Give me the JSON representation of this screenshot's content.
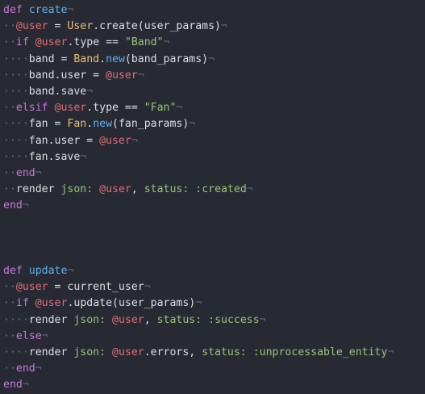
{
  "editor": {
    "colors": {
      "background": "#272a33",
      "plain": "#dcdfe4",
      "keyword": "#c678dd",
      "function": "#61afef",
      "ivar": "#e06c75",
      "constant": "#e5c07b",
      "string": "#98c379",
      "whitespace": "#5f6a7d"
    },
    "lines": [
      [
        {
          "t": "kw",
          "v": "def"
        },
        {
          "t": "plain",
          "v": " "
        },
        {
          "t": "fn",
          "v": "create"
        },
        {
          "t": "eol",
          "v": "¬"
        }
      ],
      [
        {
          "t": "ws",
          "v": "··"
        },
        {
          "t": "ivar",
          "v": "@user"
        },
        {
          "t": "plain",
          "v": " = "
        },
        {
          "t": "const",
          "v": "User"
        },
        {
          "t": "plain",
          "v": ".create(user_params)"
        },
        {
          "t": "eol",
          "v": "¬"
        }
      ],
      [
        {
          "t": "ws",
          "v": "··"
        },
        {
          "t": "kw",
          "v": "if"
        },
        {
          "t": "plain",
          "v": " "
        },
        {
          "t": "ivar",
          "v": "@user"
        },
        {
          "t": "plain",
          "v": ".type == "
        },
        {
          "t": "str",
          "v": "\"Band\""
        },
        {
          "t": "eol",
          "v": "¬"
        }
      ],
      [
        {
          "t": "ws",
          "v": "····"
        },
        {
          "t": "plain",
          "v": "band = "
        },
        {
          "t": "const",
          "v": "Band"
        },
        {
          "t": "plain",
          "v": "."
        },
        {
          "t": "method",
          "v": "new"
        },
        {
          "t": "plain",
          "v": "(band_params)"
        },
        {
          "t": "eol",
          "v": "¬"
        }
      ],
      [
        {
          "t": "ws",
          "v": "····"
        },
        {
          "t": "plain",
          "v": "band.user = "
        },
        {
          "t": "ivar",
          "v": "@user"
        },
        {
          "t": "eol",
          "v": "¬"
        }
      ],
      [
        {
          "t": "ws",
          "v": "····"
        },
        {
          "t": "plain",
          "v": "band.save"
        },
        {
          "t": "eol",
          "v": "¬"
        }
      ],
      [
        {
          "t": "ws",
          "v": "··"
        },
        {
          "t": "kw",
          "v": "elsif"
        },
        {
          "t": "plain",
          "v": " "
        },
        {
          "t": "ivar",
          "v": "@user"
        },
        {
          "t": "plain",
          "v": ".type == "
        },
        {
          "t": "str",
          "v": "\"Fan\""
        },
        {
          "t": "eol",
          "v": "¬"
        }
      ],
      [
        {
          "t": "ws",
          "v": "····"
        },
        {
          "t": "plain",
          "v": "fan = "
        },
        {
          "t": "const",
          "v": "Fan"
        },
        {
          "t": "plain",
          "v": "."
        },
        {
          "t": "method",
          "v": "new"
        },
        {
          "t": "plain",
          "v": "(fan_params)"
        },
        {
          "t": "eol",
          "v": "¬"
        }
      ],
      [
        {
          "t": "ws",
          "v": "····"
        },
        {
          "t": "plain",
          "v": "fan.user = "
        },
        {
          "t": "ivar",
          "v": "@user"
        },
        {
          "t": "eol",
          "v": "¬"
        }
      ],
      [
        {
          "t": "ws",
          "v": "····"
        },
        {
          "t": "plain",
          "v": "fan.save"
        },
        {
          "t": "eol",
          "v": "¬"
        }
      ],
      [
        {
          "t": "ws",
          "v": "··"
        },
        {
          "t": "kw",
          "v": "end"
        },
        {
          "t": "eol",
          "v": "¬"
        }
      ],
      [
        {
          "t": "ws",
          "v": "··"
        },
        {
          "t": "plain",
          "v": "render "
        },
        {
          "t": "key",
          "v": "json:"
        },
        {
          "t": "plain",
          "v": " "
        },
        {
          "t": "ivar",
          "v": "@user"
        },
        {
          "t": "plain",
          "v": ", "
        },
        {
          "t": "key",
          "v": "status:"
        },
        {
          "t": "plain",
          "v": " "
        },
        {
          "t": "sym",
          "v": ":created"
        },
        {
          "t": "eol",
          "v": "¬"
        }
      ],
      [
        {
          "t": "kw",
          "v": "end"
        },
        {
          "t": "eol",
          "v": "¬"
        }
      ],
      [],
      [],
      [],
      [
        {
          "t": "kw",
          "v": "def"
        },
        {
          "t": "plain",
          "v": " "
        },
        {
          "t": "fn",
          "v": "update"
        },
        {
          "t": "eol",
          "v": "¬"
        }
      ],
      [
        {
          "t": "ws",
          "v": "··"
        },
        {
          "t": "ivar",
          "v": "@user"
        },
        {
          "t": "plain",
          "v": " = current_user"
        },
        {
          "t": "eol",
          "v": "¬"
        }
      ],
      [
        {
          "t": "ws",
          "v": "··"
        },
        {
          "t": "kw",
          "v": "if"
        },
        {
          "t": "plain",
          "v": " "
        },
        {
          "t": "ivar",
          "v": "@user"
        },
        {
          "t": "plain",
          "v": ".update(user_params)"
        },
        {
          "t": "eol",
          "v": "¬"
        }
      ],
      [
        {
          "t": "ws",
          "v": "····"
        },
        {
          "t": "plain",
          "v": "render "
        },
        {
          "t": "key",
          "v": "json:"
        },
        {
          "t": "plain",
          "v": " "
        },
        {
          "t": "ivar",
          "v": "@user"
        },
        {
          "t": "plain",
          "v": ", "
        },
        {
          "t": "key",
          "v": "status:"
        },
        {
          "t": "plain",
          "v": " "
        },
        {
          "t": "sym",
          "v": ":success"
        },
        {
          "t": "eol",
          "v": "¬"
        }
      ],
      [
        {
          "t": "ws",
          "v": "··"
        },
        {
          "t": "kw",
          "v": "else"
        },
        {
          "t": "eol",
          "v": "¬"
        }
      ],
      [
        {
          "t": "ws",
          "v": "····"
        },
        {
          "t": "plain",
          "v": "render "
        },
        {
          "t": "key",
          "v": "json:"
        },
        {
          "t": "plain",
          "v": " "
        },
        {
          "t": "ivar",
          "v": "@user"
        },
        {
          "t": "plain",
          "v": ".errors, "
        },
        {
          "t": "key",
          "v": "status:"
        },
        {
          "t": "plain",
          "v": " "
        },
        {
          "t": "sym",
          "v": ":unprocessable_entity"
        },
        {
          "t": "eol",
          "v": "¬"
        }
      ],
      [
        {
          "t": "ws",
          "v": "··"
        },
        {
          "t": "kw",
          "v": "end"
        },
        {
          "t": "eol",
          "v": "¬"
        }
      ],
      [
        {
          "t": "kw",
          "v": "end"
        },
        {
          "t": "eol",
          "v": "¬"
        }
      ]
    ]
  }
}
